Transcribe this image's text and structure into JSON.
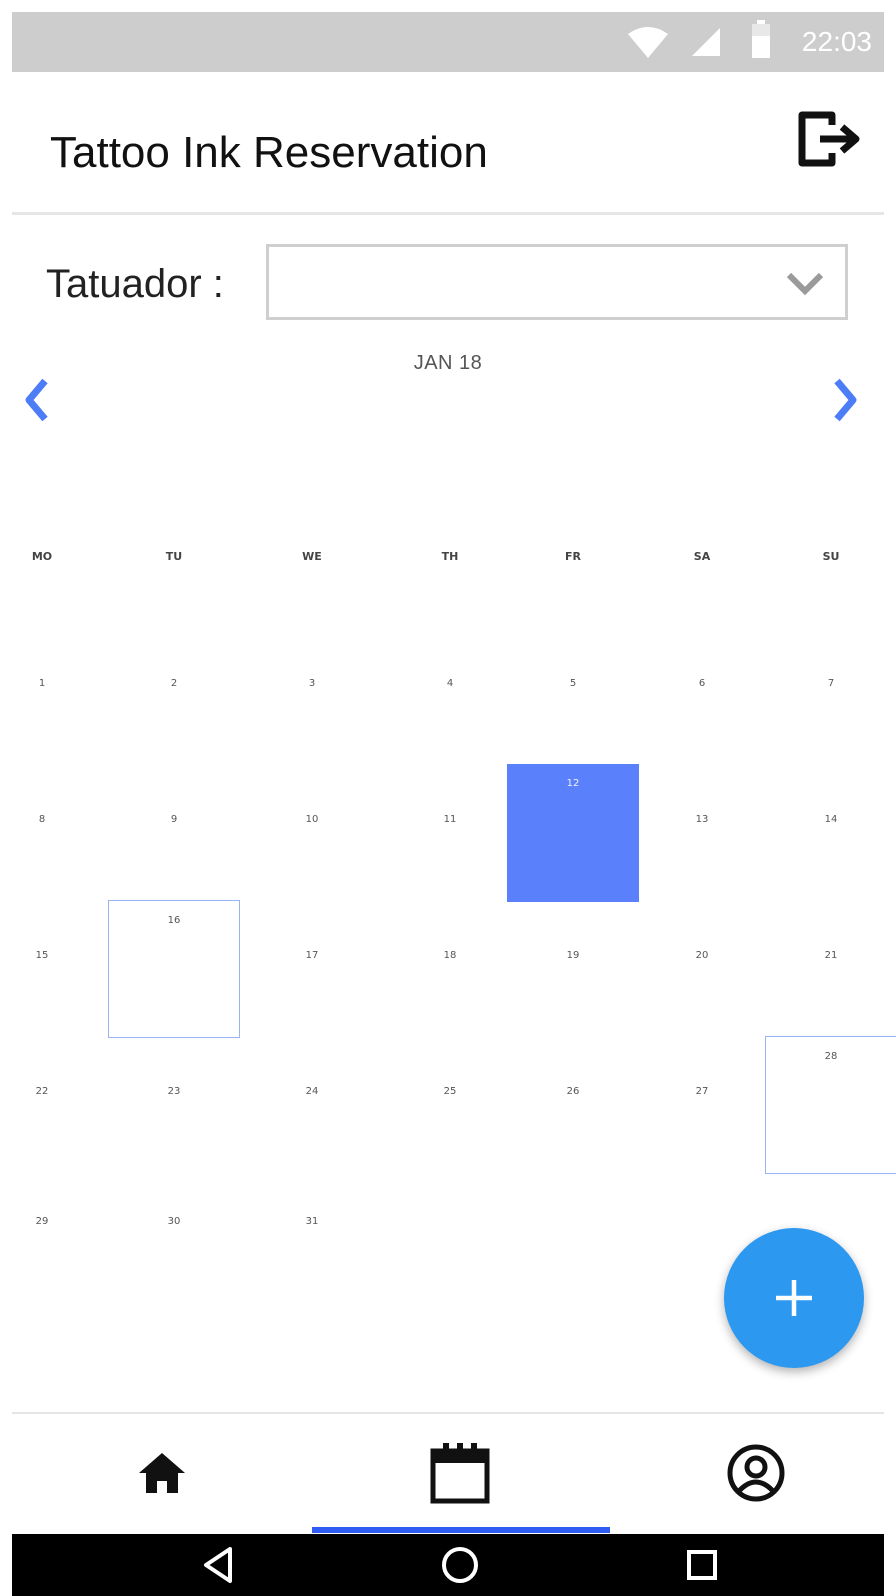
{
  "status_bar": {
    "time": "22:03"
  },
  "app_bar": {
    "title": "Tattoo Ink Reservation"
  },
  "filter": {
    "label": "Tatuador :",
    "selected_value": ""
  },
  "calendar": {
    "month_label": "JAN 18",
    "weekdays": [
      "MO",
      "TU",
      "WE",
      "TH",
      "FR",
      "SA",
      "SU"
    ],
    "weeks": [
      [
        "1",
        "2",
        "3",
        "4",
        "5",
        "6",
        "7"
      ],
      [
        "8",
        "9",
        "10",
        "11",
        "12",
        "13",
        "14"
      ],
      [
        "15",
        "16",
        "17",
        "18",
        "19",
        "20",
        "21"
      ],
      [
        "22",
        "23",
        "24",
        "25",
        "26",
        "27",
        "28"
      ],
      [
        "29",
        "30",
        "31"
      ]
    ],
    "selected_day": "12",
    "marked_days": [
      "16",
      "28"
    ],
    "colors": {
      "selected": "#5b80fb",
      "marked_border": "#9bb3f7",
      "nav_arrow": "#4c7cf6"
    }
  },
  "fab": {
    "icon": "plus-icon",
    "color": "#2c98f0"
  },
  "bottom_nav": {
    "items": [
      {
        "icon": "home-icon",
        "active": false
      },
      {
        "icon": "calendar-icon",
        "active": true
      },
      {
        "icon": "profile-icon",
        "active": false
      }
    ],
    "indicator_color": "#2f5cf2"
  },
  "system_nav": {
    "icons": [
      "back-icon",
      "home-circle-icon",
      "recents-icon"
    ]
  }
}
